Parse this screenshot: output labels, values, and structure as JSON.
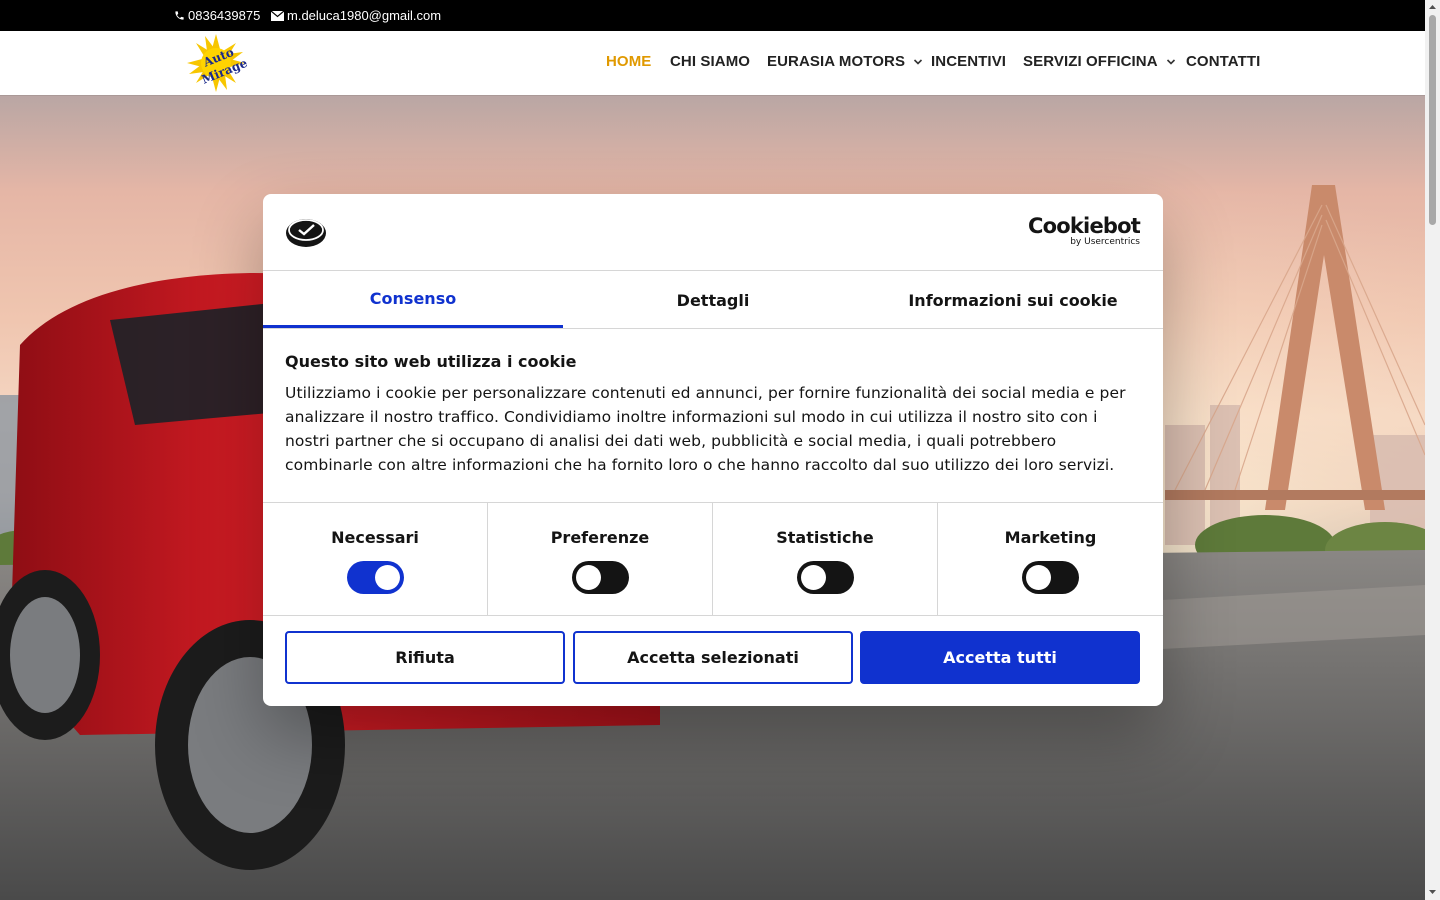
{
  "topbar": {
    "phone": "0836439875",
    "email": "m.deluca1980@gmail.com"
  },
  "header": {
    "logo_text": [
      "Auto",
      "Mirage"
    ],
    "nav": [
      {
        "label": "HOME",
        "active": true,
        "has_dropdown": false
      },
      {
        "label": "CHI SIAMO",
        "active": false,
        "has_dropdown": false
      },
      {
        "label": "EURASIA MOTORS",
        "active": false,
        "has_dropdown": true
      },
      {
        "label": "INCENTIVI",
        "active": false,
        "has_dropdown": false
      },
      {
        "label": "SERVIZI OFFICINA",
        "active": false,
        "has_dropdown": true
      },
      {
        "label": "CONTATTI",
        "active": false,
        "has_dropdown": false
      }
    ]
  },
  "cookie_dialog": {
    "brand_name": "Cookiebot",
    "brand_by": "by Usercentrics",
    "tabs": [
      {
        "label": "Consenso",
        "active": true
      },
      {
        "label": "Dettagli",
        "active": false
      },
      {
        "label": "Informazioni sui cookie",
        "active": false
      }
    ],
    "title": "Questo sito web utilizza i cookie",
    "text": "Utilizziamo i cookie per personalizzare contenuti ed annunci, per fornire funzionalità dei social media e per analizzare il nostro traffico. Condividiamo inoltre informazioni sul modo in cui utilizza il nostro sito con i nostri partner che si occupano di analisi dei dati web, pubblicità e social media, i quali potrebbero combinarle con altre informazioni che ha fornito loro o che hanno raccolto dal suo utilizzo dei loro servizi.",
    "categories": [
      {
        "label": "Necessari",
        "enabled": true
      },
      {
        "label": "Preferenze",
        "enabled": false
      },
      {
        "label": "Statistiche",
        "enabled": false
      },
      {
        "label": "Marketing",
        "enabled": false
      }
    ],
    "buttons": {
      "reject": "Rifiuta",
      "accept_selected": "Accetta selezionati",
      "accept_all": "Accetta tutti"
    }
  },
  "colors": {
    "accent": "#1032cf",
    "nav_active": "#e09900",
    "topbar_bg": "#000000",
    "car_red": "#c8141e"
  }
}
